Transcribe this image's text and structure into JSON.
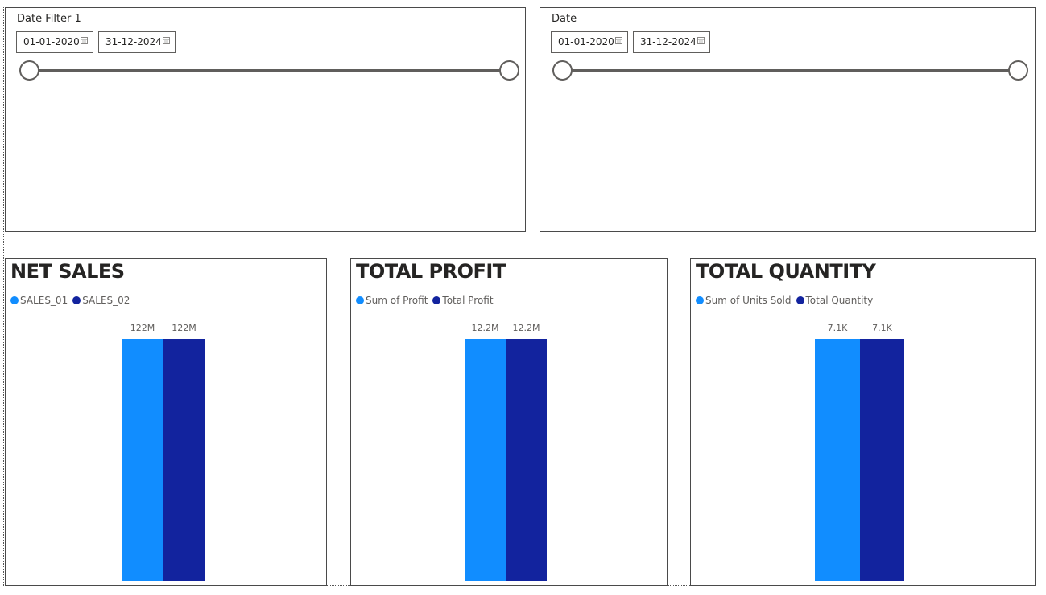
{
  "slicers": [
    {
      "title": "Date Filter 1",
      "start": "01-01-2020",
      "end": "31-12-2024"
    },
    {
      "title": "Date",
      "start": "01-01-2020",
      "end": "31-12-2024"
    }
  ],
  "colors": {
    "series1": "#118dff",
    "series2": "#12239e",
    "border": "#4a4a4a",
    "slider": "#605e5c"
  },
  "icons": {
    "calendar": "calendar-icon"
  },
  "chart_data": [
    {
      "type": "bar",
      "title": "NET SALES",
      "series": [
        {
          "name": "SALES_01",
          "values": [
            122000000
          ],
          "label": "122M"
        },
        {
          "name": "SALES_02",
          "values": [
            122000000
          ],
          "label": "122M"
        }
      ]
    },
    {
      "type": "bar",
      "title": "TOTAL PROFIT",
      "series": [
        {
          "name": "Sum of Profit",
          "values": [
            12200000
          ],
          "label": "12.2M"
        },
        {
          "name": "Total Profit",
          "values": [
            12200000
          ],
          "label": "12.2M"
        }
      ]
    },
    {
      "type": "bar",
      "title": "TOTAL QUANTITY",
      "series": [
        {
          "name": "Sum of Units Sold",
          "values": [
            7100
          ],
          "label": "7.1K"
        },
        {
          "name": "Total Quantity",
          "values": [
            7100
          ],
          "label": "7.1K"
        }
      ]
    }
  ]
}
